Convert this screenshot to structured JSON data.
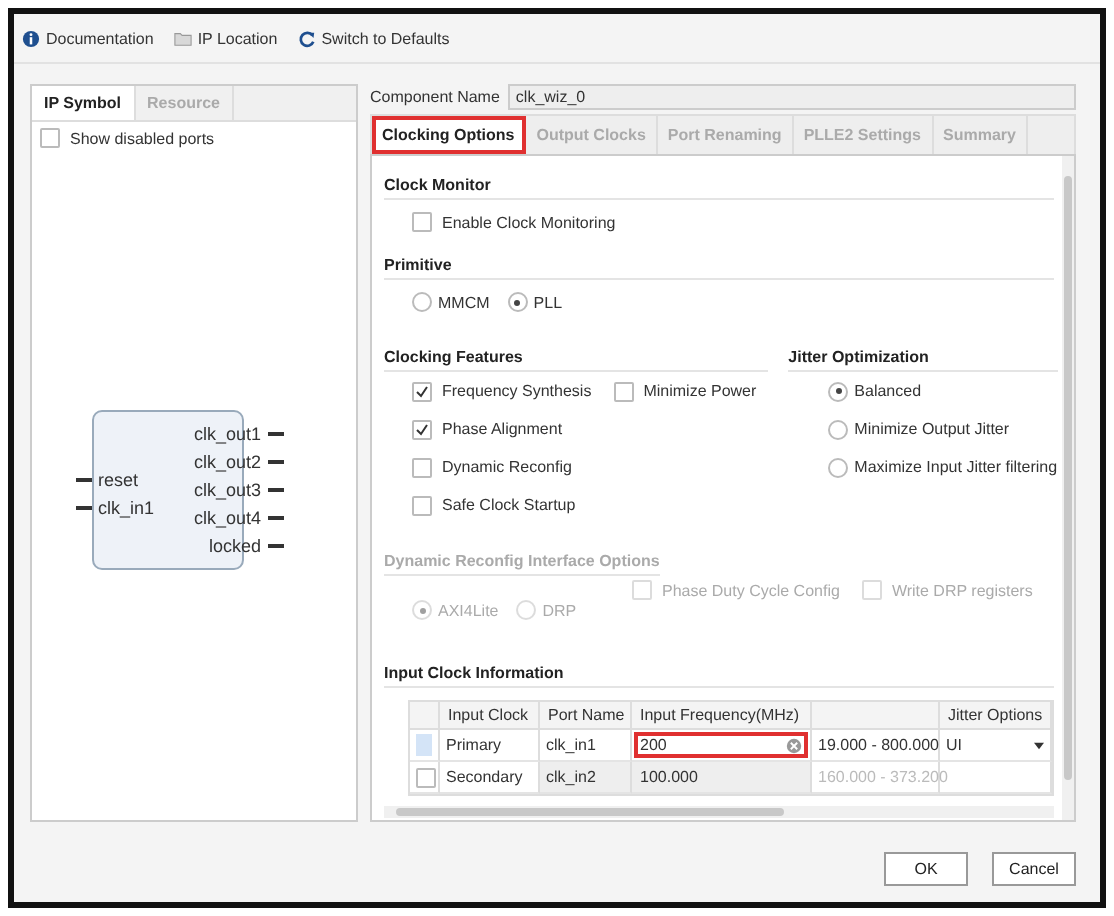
{
  "toolbar": [
    {
      "kind": "info",
      "label": "Documentation"
    },
    {
      "kind": "folder",
      "label": "IP Location"
    },
    {
      "kind": "refresh",
      "label": "Switch to Defaults"
    }
  ],
  "left_panel": {
    "tabs": [
      {
        "label": "IP Symbol",
        "selected": true
      },
      {
        "label": "Resource",
        "selected": false
      }
    ],
    "show_disabled_ports": {
      "label": "Show disabled ports",
      "checked": false
    },
    "symbol": {
      "inputs": [
        "reset",
        "clk_in1"
      ],
      "outputs": [
        "clk_out1",
        "clk_out2",
        "clk_out3",
        "clk_out4",
        "locked"
      ]
    }
  },
  "component_name": {
    "label": "Component Name",
    "value": "clk_wiz_0"
  },
  "tabs": [
    {
      "label": "Clocking Options",
      "selected": true,
      "highlighted": true
    },
    {
      "label": "Output Clocks",
      "selected": false,
      "highlighted": false
    },
    {
      "label": "Port Renaming",
      "selected": false,
      "highlighted": false
    },
    {
      "label": "PLLE2 Settings",
      "selected": false,
      "highlighted": false
    },
    {
      "label": "Summary",
      "selected": false,
      "highlighted": false
    }
  ],
  "clock_monitor": {
    "title": "Clock Monitor",
    "options": [
      {
        "label": "Enable Clock Monitoring",
        "checked": false
      }
    ]
  },
  "primitive": {
    "title": "Primitive",
    "options": [
      {
        "label": "MMCM",
        "selected": false
      },
      {
        "label": "PLL",
        "selected": true
      }
    ]
  },
  "clocking_features": {
    "title": "Clocking Features",
    "rows": [
      [
        {
          "label": "Frequency Synthesis",
          "checked": true
        },
        {
          "label": "Minimize Power",
          "checked": false
        }
      ],
      [
        {
          "label": "Phase Alignment",
          "checked": true
        }
      ],
      [
        {
          "label": "Dynamic Reconfig",
          "checked": false
        }
      ],
      [
        {
          "label": "Safe Clock Startup",
          "checked": false
        }
      ]
    ]
  },
  "jitter_optimization": {
    "title": "Jitter Optimization",
    "options": [
      {
        "label": "Balanced",
        "selected": true
      },
      {
        "label": "Minimize Output Jitter",
        "selected": false
      },
      {
        "label": "Maximize Input Jitter filtering",
        "selected": false
      }
    ]
  },
  "dynamic_reconfig": {
    "title": "Dynamic Reconfig Interface Options",
    "disabled": true,
    "radios": [
      {
        "label": "AXI4Lite",
        "selected": true
      },
      {
        "label": "DRP",
        "selected": false
      }
    ],
    "checkboxes": [
      {
        "label": "Phase Duty Cycle Config",
        "checked": false
      },
      {
        "label": "Write DRP registers",
        "checked": false
      }
    ]
  },
  "input_clock": {
    "title": "Input Clock Information",
    "columns": [
      "Input Clock",
      "Port Name",
      "Input Frequency(MHz)",
      "Jitter Options"
    ],
    "rows": [
      {
        "selected": true,
        "disabled": false,
        "input_clock": "Primary",
        "port_name": "clk_in1",
        "frequency": "200",
        "range": "19.000 - 800.000",
        "jitter": "UI",
        "highlighted": true
      },
      {
        "selected": false,
        "disabled": true,
        "input_clock": "Secondary",
        "port_name": "clk_in2",
        "frequency": "100.000",
        "range": "160.000 - 373.200",
        "highlighted": false
      }
    ]
  },
  "buttons": [
    "OK",
    "Cancel"
  ]
}
